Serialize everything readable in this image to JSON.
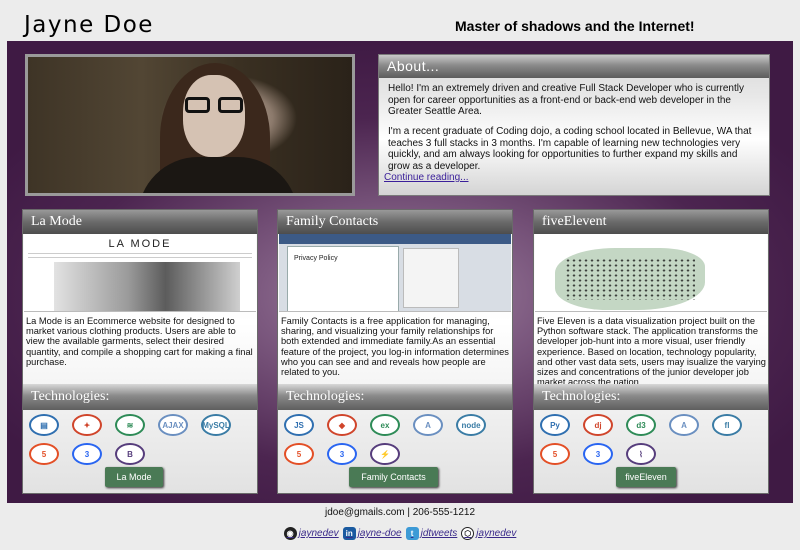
{
  "header": {
    "name": "Jayne Doe",
    "tagline": "Master of shadows and the Internet!"
  },
  "about": {
    "title": "About...",
    "p1": "Hello! I'm an extremely driven and creative Full Stack Developer who is currently open for career opportunities as a front-end or back-end web developer in the Greater Seattle Area.",
    "p2": "I'm a recent graduate of Coding dojo, a coding school located in Bellevue, WA that teaches 3 full stacks in 3 months. I'm capable of learning new technologies very quickly, and am always looking for opportunities to further expand my skills and grow as a developer.",
    "link": "Continue reading..."
  },
  "projects": [
    {
      "title": "La Mode",
      "description": "La Mode is an Ecommerce website for designed to market various clothing products. Users are able to view the available garments, select their desired quantity, and compile a shopping cart for making a final purchase.",
      "tech_label": "Technologies:",
      "icons": [
        "mongodb-icon",
        "laravel-icon",
        "stack-icon",
        "ajax-icon",
        "mysql-icon",
        "html5-icon",
        "css3-icon",
        "bootstrap-icon"
      ],
      "icon_glyphs": [
        "▤",
        "✦",
        "≋",
        "AJAX",
        "MySQL",
        "5",
        "3",
        "B"
      ],
      "button": "La Mode",
      "shot_logo": "LA MODE"
    },
    {
      "title": "Family Contacts",
      "description": "Family Contacts is a free application for managing, sharing, and visualizing your family relationships for both extended and immediate family.As an essential feature of the project, you log-in information determines who you can see and and reveals how people are related to you.",
      "tech_label": "Technologies:",
      "icons": [
        "javascript-icon",
        "mongodb-icon",
        "express-icon",
        "angular-icon",
        "node-icon",
        "html5-icon",
        "css3-icon",
        "socketio-icon"
      ],
      "icon_glyphs": [
        "JS",
        "◆",
        "ex",
        "A",
        "node",
        "5",
        "3",
        "⚡"
      ],
      "button": "Family Contacts",
      "shot_heading": "Privacy Policy"
    },
    {
      "title": "fiveElevent",
      "description": "Five Eleven is a data visualization project built on the Python software stack. The application transforms the developer job-hunt into a more visual, user friendly experience. Based on location, technology popularity, and other vast data sets, users may isualize the varying sizes and concentrations of the junior developer job market across the nation.",
      "tech_label": "Technologies:",
      "icons": [
        "python-icon",
        "django-icon",
        "d3-icon",
        "angular-icon",
        "flask-icon",
        "html5-icon",
        "css3-icon",
        "heroku-icon"
      ],
      "icon_glyphs": [
        "Py",
        "dj",
        "d3",
        "A",
        "fl",
        "5",
        "3",
        "⌇"
      ],
      "button": "fiveEleven"
    }
  ],
  "footer": {
    "contact": "jdoe@gmails.com | 206-555-1212",
    "socials": [
      {
        "icon": "github-icon",
        "label": "jaynedev"
      },
      {
        "icon": "linkedin-icon",
        "label": "jayne-doe"
      },
      {
        "icon": "twitter-icon",
        "label": "jdtweets"
      },
      {
        "icon": "codepen-icon",
        "label": "jaynedev"
      }
    ]
  },
  "colors": {
    "background": "#ececec",
    "main_purple": "#4c2550",
    "button_green": "#4a7a55",
    "link": "#3a1f9a"
  }
}
